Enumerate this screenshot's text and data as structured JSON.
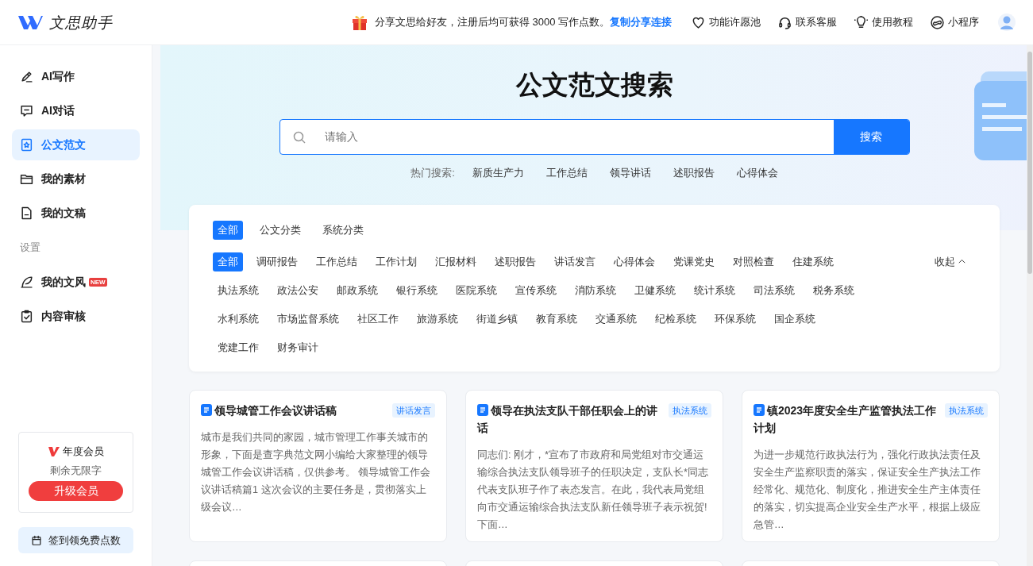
{
  "header": {
    "brand": "文思助手",
    "promo": {
      "text": "分享文思给好友，注册后均可获得 3000 写作点数。",
      "link": "复制分享连接"
    },
    "nav": [
      {
        "label": "功能许愿池"
      },
      {
        "label": "联系客服"
      },
      {
        "label": "使用教程"
      },
      {
        "label": "小程序"
      }
    ]
  },
  "sidebar": {
    "items": [
      {
        "label": "AI写作",
        "selected": false
      },
      {
        "label": "AI对话",
        "selected": false
      },
      {
        "label": "公文范文",
        "selected": true
      },
      {
        "label": "我的素材",
        "selected": false
      },
      {
        "label": "我的文稿",
        "selected": false
      }
    ],
    "section_label": "设置",
    "settings_items": [
      {
        "label": "我的文风",
        "selected": false,
        "badge": "NEW"
      },
      {
        "label": "内容审核",
        "selected": false
      }
    ],
    "membership": {
      "plan": "年度会员",
      "remaining": "剩余无限字",
      "button": "升级会员"
    },
    "checkin": "签到领免费点数"
  },
  "hero": {
    "title": "公文范文搜索",
    "search": {
      "placeholder": "请输入",
      "button": "搜索"
    },
    "hot_label": "热门搜索:",
    "hot": [
      "新质生产力",
      "工作总结",
      "领导讲话",
      "述职报告",
      "心得体会"
    ]
  },
  "filters": {
    "groups": [
      {
        "label": "全部",
        "selected": true
      },
      {
        "label": "公文分类",
        "selected": false
      },
      {
        "label": "系统分类",
        "selected": false
      }
    ],
    "categories": [
      {
        "label": "全部",
        "selected": true
      },
      {
        "label": "调研报告",
        "selected": false
      },
      {
        "label": "工作总结",
        "selected": false
      },
      {
        "label": "工作计划",
        "selected": false
      },
      {
        "label": "汇报材料",
        "selected": false
      },
      {
        "label": "述职报告",
        "selected": false
      },
      {
        "label": "讲话发言",
        "selected": false
      },
      {
        "label": "心得体会",
        "selected": false
      },
      {
        "label": "党课党史",
        "selected": false
      },
      {
        "label": "对照检查",
        "selected": false
      },
      {
        "label": "住建系统",
        "selected": false
      },
      {
        "label": "执法系统",
        "selected": false
      },
      {
        "label": "政法公安",
        "selected": false
      },
      {
        "label": "邮政系统",
        "selected": false
      },
      {
        "label": "银行系统",
        "selected": false
      },
      {
        "label": "医院系统",
        "selected": false
      },
      {
        "label": "宣传系统",
        "selected": false
      },
      {
        "label": "消防系统",
        "selected": false
      },
      {
        "label": "卫健系统",
        "selected": false
      },
      {
        "label": "统计系统",
        "selected": false
      },
      {
        "label": "司法系统",
        "selected": false
      },
      {
        "label": "税务系统",
        "selected": false
      },
      {
        "label": "水利系统",
        "selected": false
      },
      {
        "label": "市场监督系统",
        "selected": false
      },
      {
        "label": "社区工作",
        "selected": false
      },
      {
        "label": "旅游系统",
        "selected": false
      },
      {
        "label": "街道乡镇",
        "selected": false
      },
      {
        "label": "教育系统",
        "selected": false
      },
      {
        "label": "交通系统",
        "selected": false
      },
      {
        "label": "纪检系统",
        "selected": false
      },
      {
        "label": "环保系统",
        "selected": false
      },
      {
        "label": "国企系统",
        "selected": false
      },
      {
        "label": "党建工作",
        "selected": false
      },
      {
        "label": "财务审计",
        "selected": false
      }
    ],
    "collapse": "收起"
  },
  "articles": [
    {
      "title": "领导城管工作会议讲话稿",
      "tag": "讲话发言",
      "excerpt": "城市是我们共同的家园，城市管理工作事关城市的形象，下面是查字典范文网小编给大家整理的领导城管工作会议讲话稿，仅供参考。 领导城管工作会议讲话稿篇1 这次会议的主要任务是，贯彻落实上级会议…"
    },
    {
      "title": "领导在执法支队干部任职会上的讲话",
      "tag": "执法系统",
      "excerpt": "同志们: 刚才，*宣布了市政府和局党组对市交通运输综合执法支队领导班子的任职决定，支队长*同志代表支队班子作了表态发言。在此，我代表局党组向市交通运输综合执法支队新任领导班子表示祝贺!下面…"
    },
    {
      "title": "镇2023年度安全生产监管执法工作计划",
      "tag": "执法系统",
      "excerpt": "为进一步规范行政执法行为，强化行政执法责任及安全生产监察职责的落实，保证安全生产执法工作经常化、规范化、制度化，推进安全生产主体责任的落实，切实提高企业安全生产水平，根据上级应急管…"
    }
  ]
}
